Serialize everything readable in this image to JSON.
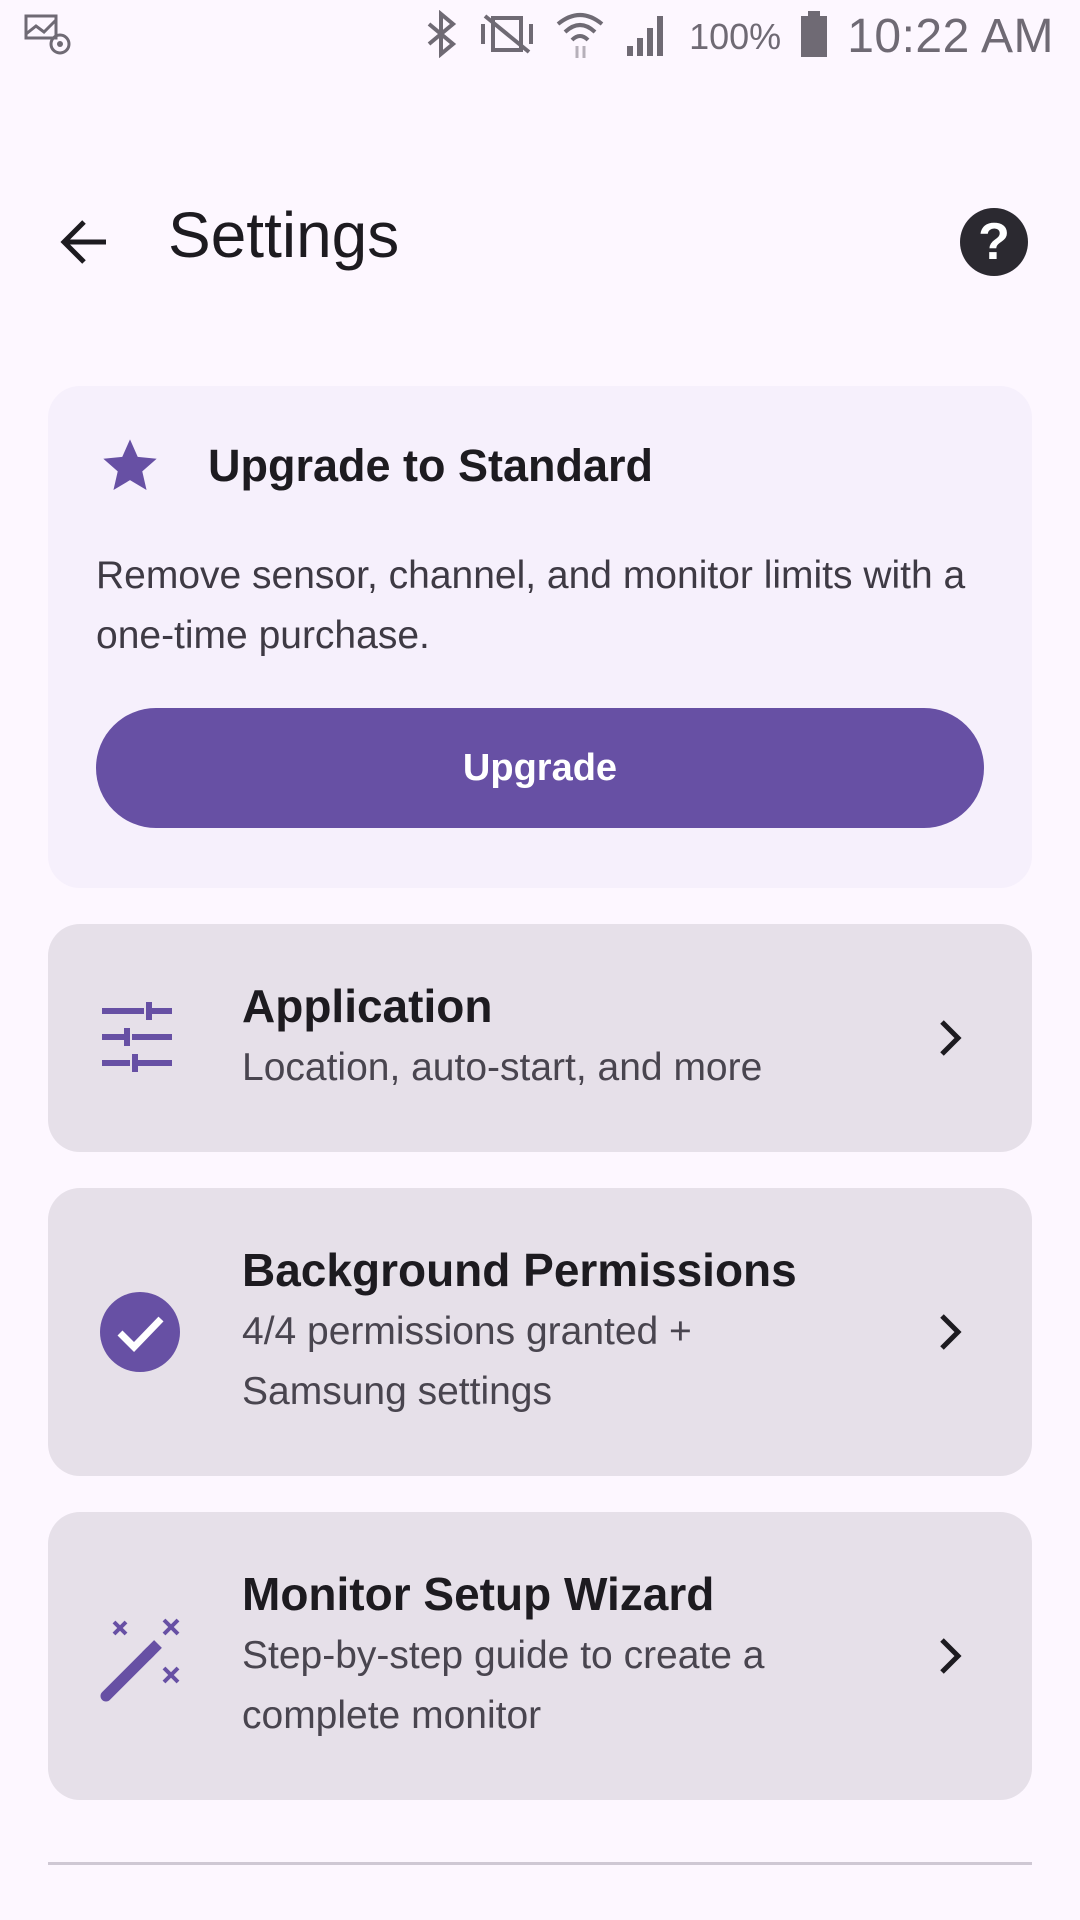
{
  "status_bar": {
    "battery_percent": "100%",
    "time": "10:22 AM",
    "icons": [
      "notification-icon",
      "bluetooth-icon",
      "vibrate-icon",
      "wifi-icon",
      "signal-icon",
      "battery-icon"
    ]
  },
  "app_bar": {
    "title": "Settings",
    "back_icon": "arrow-back-icon",
    "help_icon": "help-icon",
    "help_glyph": "?"
  },
  "upgrade": {
    "icon": "star-icon",
    "title": "Upgrade to Standard",
    "description": "Remove sensor, channel, and monitor limits with a one-time purchase.",
    "button_label": "Upgrade"
  },
  "items": [
    {
      "icon": "tune-sliders-icon",
      "title": "Application",
      "subtitle": "Location, auto-start, and more"
    },
    {
      "icon": "check-circle-icon",
      "title": "Background Permissions",
      "subtitle": "4/4 permissions granted + Samsung settings"
    },
    {
      "icon": "magic-wand-icon",
      "title": "Monitor Setup Wizard",
      "subtitle": "Step-by-step guide to create a complete monitor"
    }
  ],
  "colors": {
    "primary": "#6750a4",
    "background": "#fdf7ff",
    "card": "#e6e0e9",
    "upgrade_card": "#f6f0fc"
  }
}
